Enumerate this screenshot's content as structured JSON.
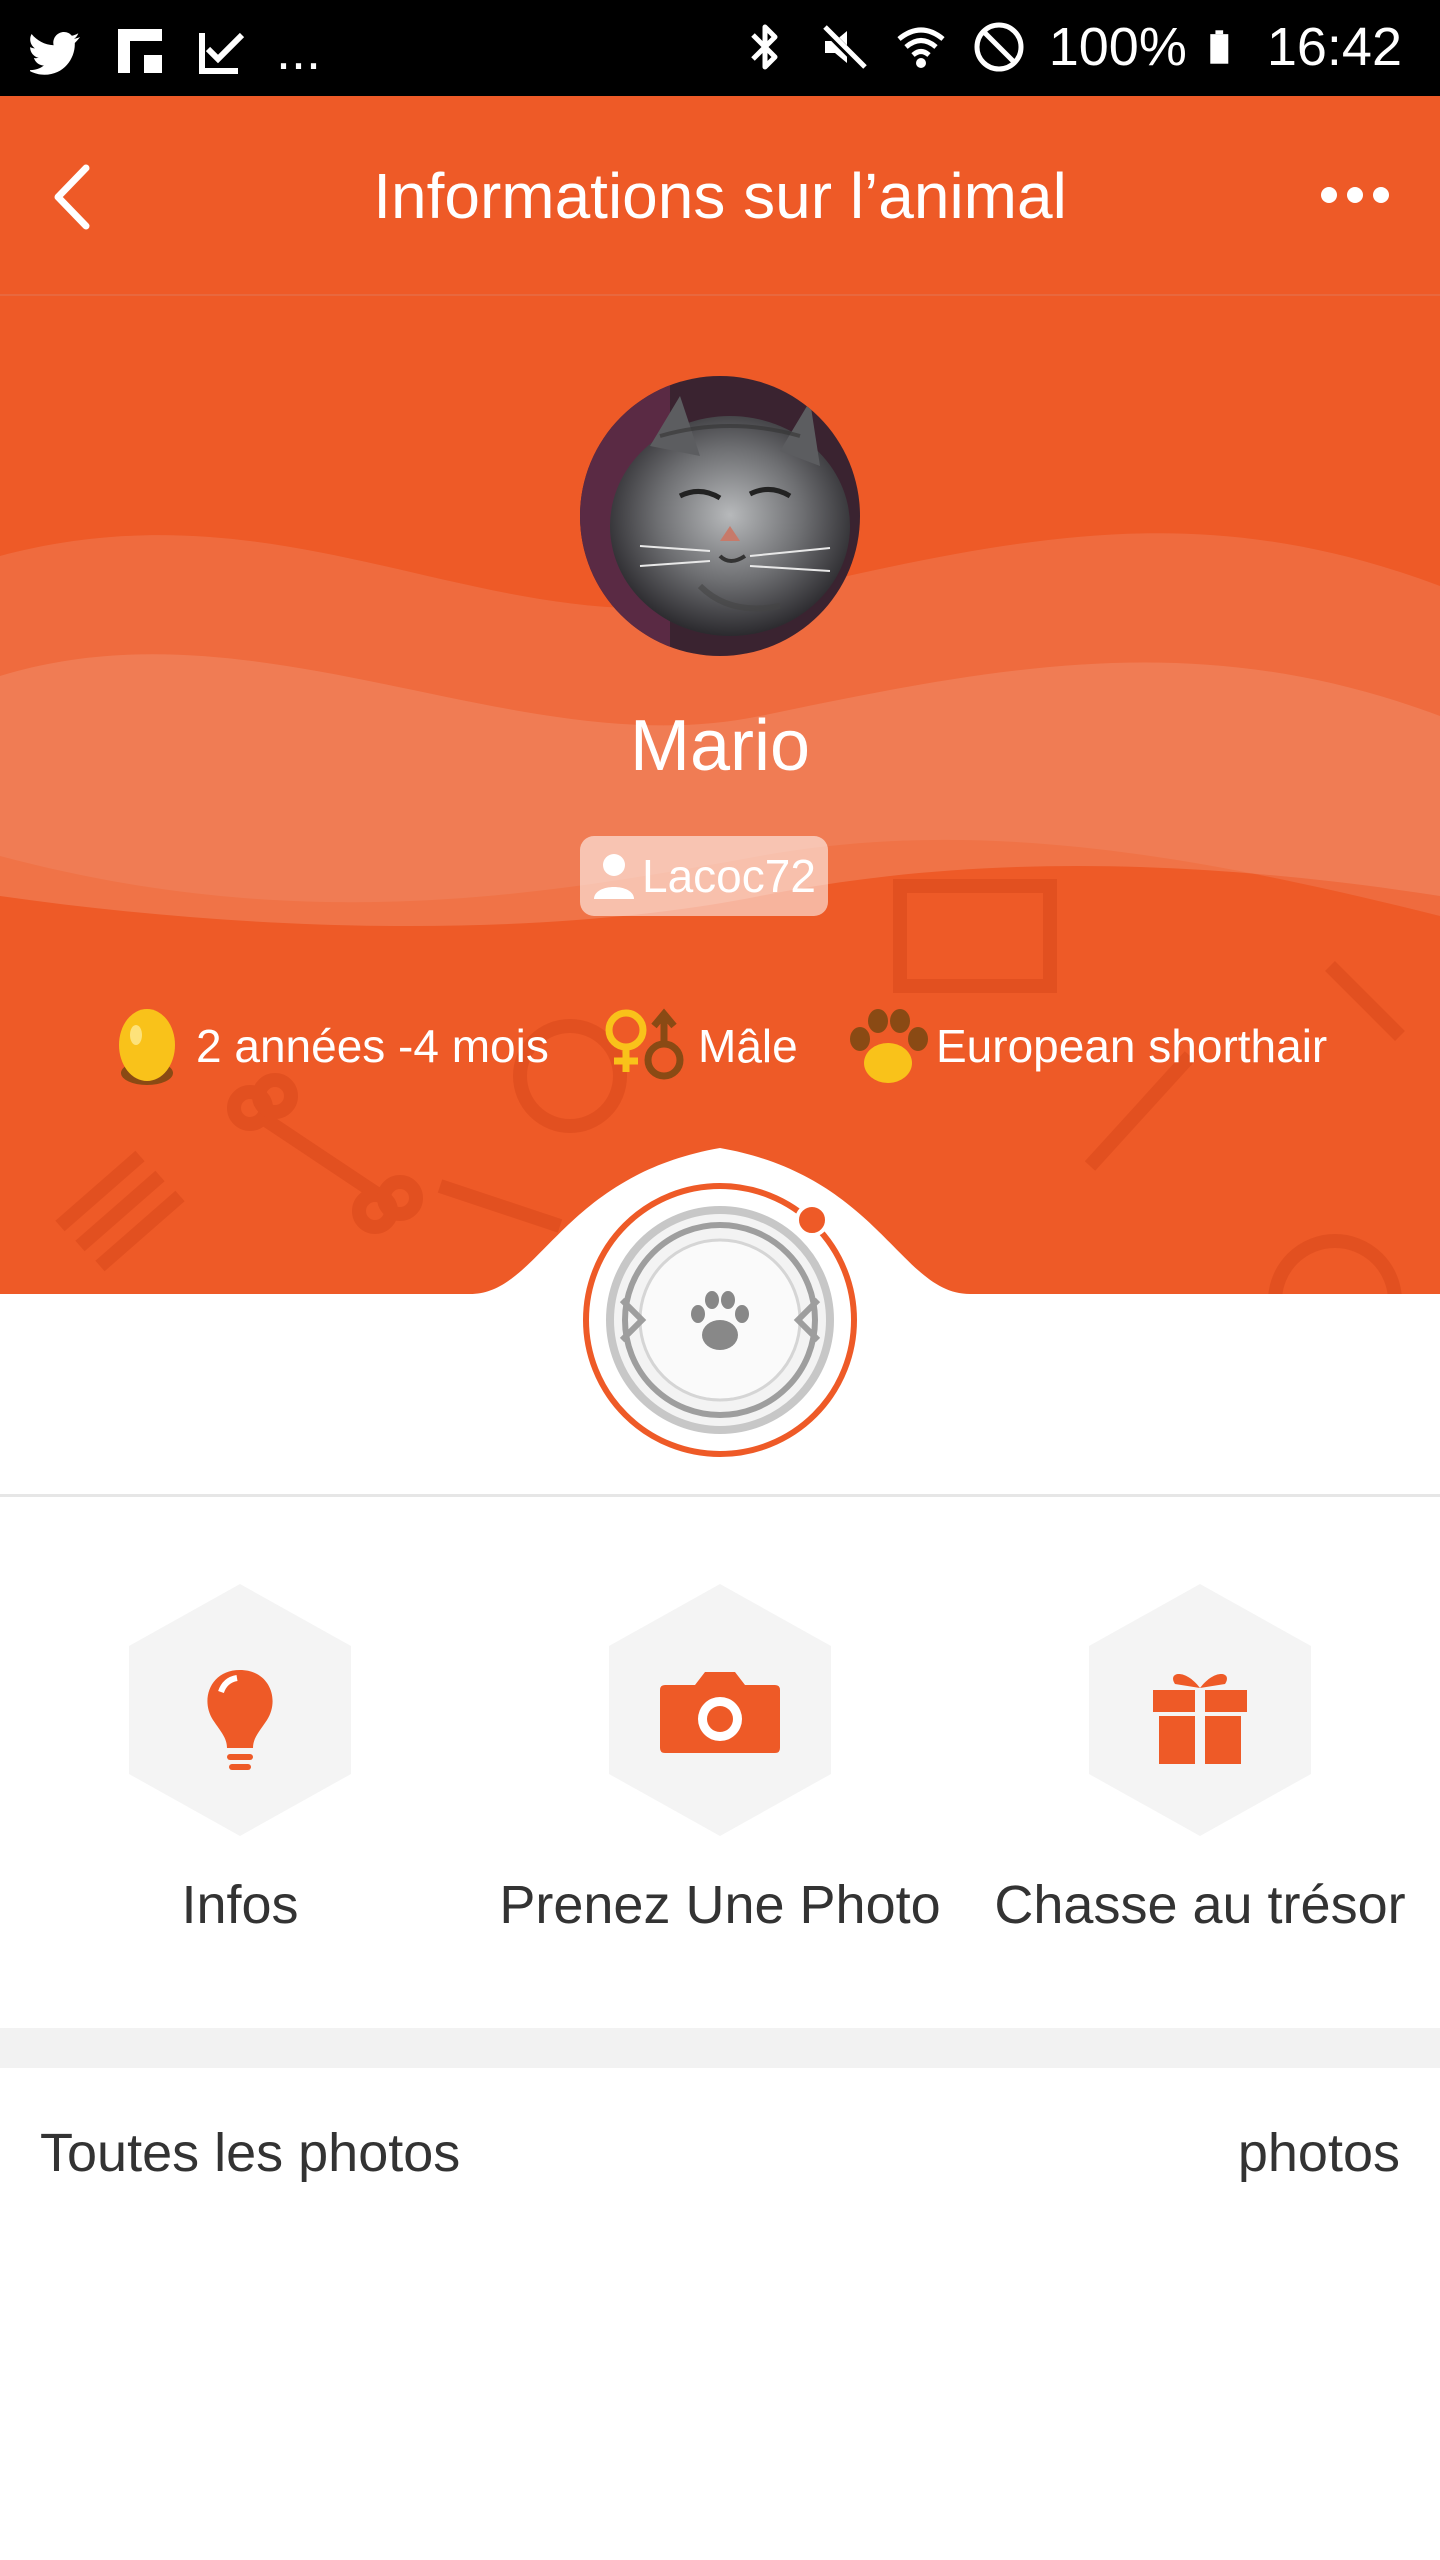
{
  "status_bar": {
    "battery": "100%",
    "time": "16:42",
    "ellipsis": "..."
  },
  "header": {
    "title": "Informations sur l’animal"
  },
  "pet": {
    "name": "Mario",
    "owner": "Lacoc72",
    "age": "2 années -4 mois",
    "sex": "Mâle",
    "breed": "European shorthair"
  },
  "actions": [
    {
      "label": "Infos",
      "icon": "lightbulb-icon"
    },
    {
      "label": "Prenez Une Photo",
      "icon": "camera-icon"
    },
    {
      "label": "Chasse au trésor",
      "icon": "gift-icon"
    }
  ],
  "photos": {
    "all_label": "Toutes les photos",
    "count_label": "photos"
  },
  "colors": {
    "accent": "#EE5A27",
    "hex_bg": "#F4F4F4",
    "egg": "#F9C21A"
  }
}
